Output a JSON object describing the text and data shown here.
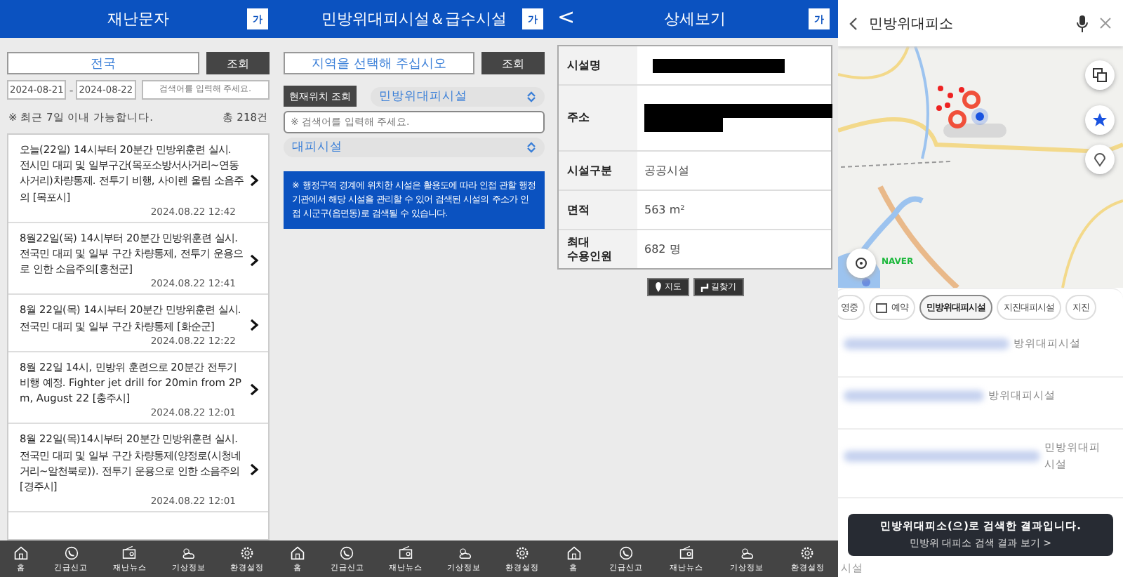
{
  "disaster_messages": {
    "title": "재난문자",
    "font_button": "가",
    "region": "전국",
    "search_button": "조회",
    "date_from": "2024-08-21",
    "date_separator": "-",
    "date_to": "2024-08-22",
    "search_placeholder": "검색어를 입력해 주세요.",
    "note": "※ 최근 7일 이내 가능합니다.",
    "total": "총 218건",
    "messages": [
      {
        "text": "오늘(22일) 14시부터 20분간 민방위훈련 실시. 전시민 대피 및 일부구간(목포소방서사거리~연동사거리)차량통제. 전투기 비행, 사이렌 울림 소음주의 [목포시]",
        "time": "2024.08.22 12:42"
      },
      {
        "text": "8월22일(목) 14시부터 20분간 민방위훈련 실시. 전국민 대피 및 일부 구간 차량통제, 전투기 운용으로 인한 소음주의[홍천군]",
        "time": "2024.08.22 12:41"
      },
      {
        "text": "8월 22일(목) 14시부터 20분간 민방위훈련 실시. 전국민 대피 및 일부 구간 차량통제 [화순군]",
        "time": "2024.08.22 12:22"
      },
      {
        "text": "8월 22일 14시, 민방위 훈련으로 20분간 전투기 비행 예정. Fighter jet drill for 20min from 2Pm, August 22 [충주시]",
        "time": "2024.08.22 12:01"
      },
      {
        "text": "8월 22일(목)14시부터 20분간 민방위훈련 실시. 전국민 대피 및 일부 구간 차량통제(양정로(시청네거리~알천북로)). 전투기 운용으로 인한 소음주의[경주시]",
        "time": "2024.08.22 12:01"
      }
    ],
    "nav": [
      {
        "label": "홈"
      },
      {
        "label": "긴급신고"
      },
      {
        "label": "재난뉴스"
      },
      {
        "label": "기상정보"
      },
      {
        "label": "환경설정"
      }
    ]
  },
  "shelters": {
    "title": "민방위대피시설＆급수시설",
    "font_button": "가",
    "region_placeholder": "지역을 선택해 주십시오",
    "search_button": "조회",
    "location_button": "현재위치 조회",
    "facility_select": "민방위대피시설",
    "search_placeholder": "※ 검색어를 입력해 주세요.",
    "type_select": "대피시설",
    "notice": "※ 행정구역 경계에 위치한 시설은 활용도에 따라 인접 관할 행정기관에서 해당 시설을 관리할 수 있어 검색된 시설의 주소가 인접 시군구(읍면동)로 검색될 수 있습니다.",
    "nav": [
      {
        "label": "홈"
      },
      {
        "label": "긴급신고"
      },
      {
        "label": "재난뉴스"
      },
      {
        "label": "기상정보"
      },
      {
        "label": "환경설정"
      }
    ]
  },
  "detail": {
    "back": "<",
    "title": "상세보기",
    "font_button": "가",
    "rows": [
      {
        "label": "시설명",
        "redacted": true
      },
      {
        "label": "주소",
        "redacted": true
      },
      {
        "label": "시설구분",
        "value": "공공시설"
      },
      {
        "label": "면적",
        "value": "563 m²"
      },
      {
        "label": "최대\n수용인원",
        "value": "682 명"
      }
    ],
    "buttons": [
      {
        "label": "지도"
      },
      {
        "label": "길찾기"
      }
    ],
    "nav": [
      {
        "label": "홈"
      },
      {
        "label": "긴급신고"
      },
      {
        "label": "재난뉴스"
      },
      {
        "label": "기상정보"
      },
      {
        "label": "환경설정"
      }
    ]
  },
  "map": {
    "search_value": "민방위대피소",
    "map_logo": "NAVER",
    "chips": [
      {
        "label": "영중",
        "selected": false
      },
      {
        "label": "예약",
        "selected": false,
        "kind": "icon"
      },
      {
        "label": "민방위대피시설",
        "selected": true
      },
      {
        "label": "지진대피시설",
        "selected": false
      },
      {
        "label": "지진",
        "selected": false
      }
    ],
    "results": [
      {
        "category": "방위대피시설"
      },
      {
        "category": "방위대피시설"
      },
      {
        "category": "민방위대피\n시설"
      }
    ],
    "toast": {
      "title": "민방위대피소(으)로 검색한 결과입니다.",
      "link": "민방위 대피소 검색 결과 보기 >"
    },
    "peek_text": "시설"
  }
}
